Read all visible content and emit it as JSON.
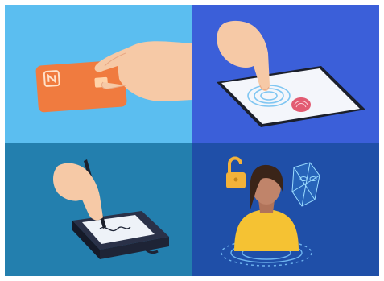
{
  "panels": [
    {
      "id": "nfc-card-payment",
      "bg": "#5bbef0"
    },
    {
      "id": "fingerprint-phone",
      "bg": "#3b5fd9"
    },
    {
      "id": "signature-pad",
      "bg": "#237fae"
    },
    {
      "id": "face-recognition",
      "bg": "#1f4fa8"
    }
  ],
  "colors": {
    "card": "#f07b3f",
    "skin": "#f6c9a6",
    "phone": "#1b1f2b",
    "pad": "#1e2436",
    "shirt": "#f5c233",
    "lock": "#f3b23a"
  },
  "icons": [
    "nfc-icon",
    "fingerprint-icon",
    "face-scan-icon",
    "padlock-icon",
    "stylus-icon"
  ]
}
